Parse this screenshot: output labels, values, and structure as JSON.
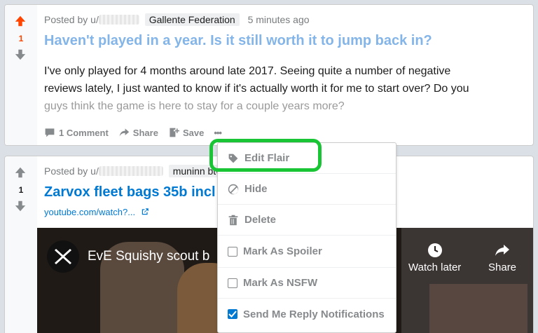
{
  "post1": {
    "score": "1",
    "posted_by": "Posted by u/",
    "flair": "Gallente Federation",
    "time": "5 minutes ago",
    "title": "Haven't played in a year. Is it still worth it to jump back in?",
    "body_line1": "I've only played for 4 months around late 2017. Seeing quite a number of negative",
    "body_line2": "reviews lately, I just wanted to know if it's actually worth it for me to start over? Do you",
    "body_line3": "guys think the game is here to stay for a couple years more?",
    "actions": {
      "comments": "1 Comment",
      "share": "Share",
      "save": "Save",
      "more": "•••"
    }
  },
  "post2": {
    "score": "1",
    "posted_by": "Posted by u/",
    "flair": "muninn btw",
    "title": "Zarvox fleet bags 35b incl",
    "link": "youtube.com/watch?...",
    "video": {
      "title": "EvE Squishy scout b",
      "watch_later": "Watch later",
      "share": "Share"
    }
  },
  "menu": {
    "edit_flair": "Edit Flair",
    "hide": "Hide",
    "delete": "Delete",
    "mark_spoiler": "Mark As Spoiler",
    "mark_nsfw": "Mark As NSFW",
    "reply_notifications": "Send Me Reply Notifications"
  },
  "colors": {
    "upvote_active": "#ff4500",
    "highlight": "#19c435",
    "link": "#0079d3",
    "checkbox_checked": "#0079d3"
  }
}
